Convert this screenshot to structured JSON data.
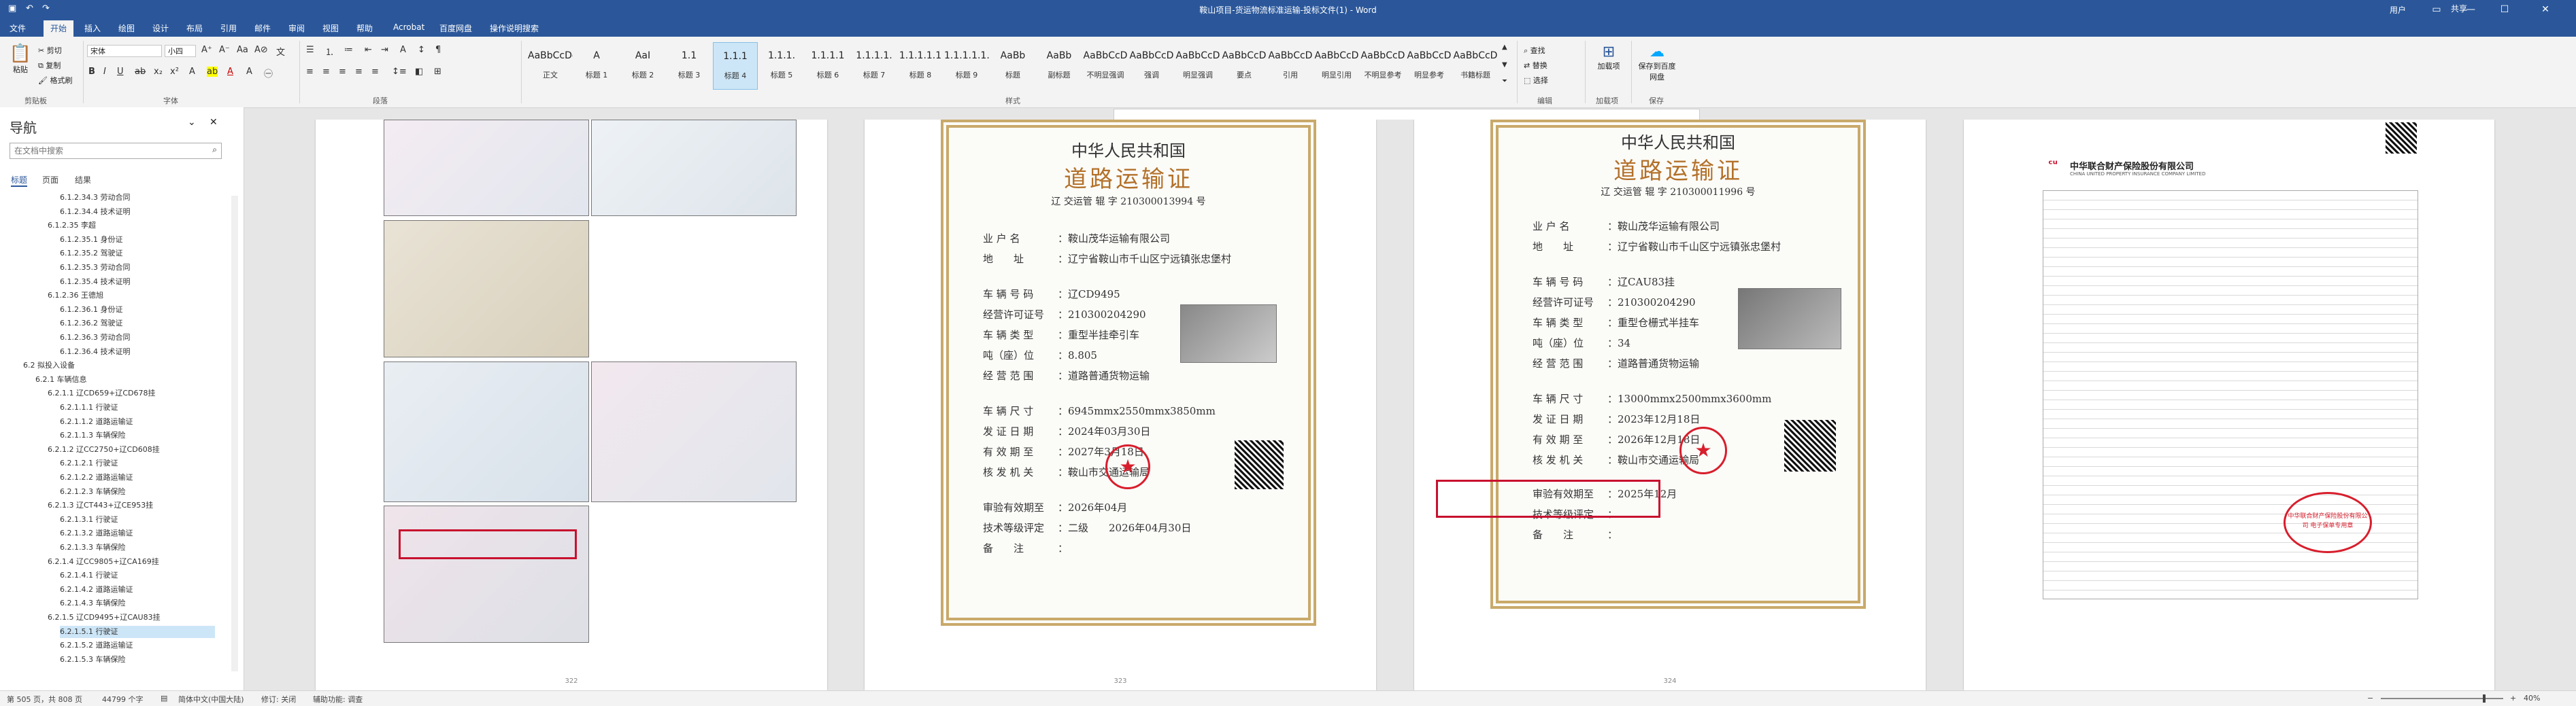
{
  "window": {
    "title": "鞍山项目-货运物流标准运输-投标文件(1) - Word",
    "user": "用户",
    "share": "共享",
    "qa_icons": [
      "save-icon",
      "undo-icon",
      "redo-icon"
    ]
  },
  "tabs": [
    "文件",
    "开始",
    "插入",
    "绘图",
    "设计",
    "布局",
    "引用",
    "邮件",
    "审阅",
    "视图",
    "帮助",
    "Acrobat",
    "百度网盘",
    "操作说明搜索"
  ],
  "active_tab": "开始",
  "ribbon": {
    "clipboard": {
      "paste": "粘贴",
      "cut": "剪切",
      "copy": "复制",
      "format_painter": "格式刷",
      "group": "剪贴板"
    },
    "font": {
      "family": "宋体",
      "size": "小四",
      "group": "字体"
    },
    "paragraph": {
      "group": "段落"
    },
    "styles": {
      "group": "样式",
      "items": [
        {
          "preview": "AaBbCcDd",
          "label": "正文"
        },
        {
          "preview": "A",
          "label": "标题 1"
        },
        {
          "preview": "AaI",
          "label": "标题 2"
        },
        {
          "preview": "1.1",
          "label": "标题 3"
        },
        {
          "preview": "1.1.1",
          "label": "标题 4"
        },
        {
          "preview": "1.1.1.",
          "label": "标题 5"
        },
        {
          "preview": "1.1.1.1",
          "label": "标题 6"
        },
        {
          "preview": "1.1.1.1.",
          "label": "标题 7"
        },
        {
          "preview": "1.1.1.1.1",
          "label": "标题 8"
        },
        {
          "preview": "1.1.1.1.1.",
          "label": "标题 9"
        },
        {
          "preview": "AaBb",
          "label": "标题"
        },
        {
          "preview": "AaBb",
          "label": "副标题"
        },
        {
          "preview": "AaBbCcD",
          "label": "不明显强调"
        },
        {
          "preview": "AaBbCcD",
          "label": "强调"
        },
        {
          "preview": "AaBbCcD",
          "label": "明显强调"
        },
        {
          "preview": "AaBbCcD",
          "label": "要点"
        },
        {
          "preview": "AaBbCcD",
          "label": "引用"
        },
        {
          "preview": "AaBbCcD",
          "label": "明显引用"
        },
        {
          "preview": "AaBbCcD",
          "label": "不明显参考"
        },
        {
          "preview": "AaBbCcD",
          "label": "明显参考"
        },
        {
          "preview": "AaBbCcD",
          "label": "书籍标题"
        }
      ],
      "selected_index": 4
    },
    "editing": {
      "find": "查找",
      "replace": "替换",
      "select": "选择",
      "group": "编辑"
    },
    "addin": {
      "label": "加载项",
      "group": "加载项"
    },
    "save_baidu": {
      "label": "保存到百度网盘",
      "group": "保存"
    }
  },
  "nav": {
    "title": "导航",
    "search_placeholder": "在文档中搜索",
    "tabs": [
      "标题",
      "页面",
      "结果"
    ],
    "items": [
      {
        "text": "6.1.2.34.3 劳动合同",
        "level": 4
      },
      {
        "text": "6.1.2.34.4 技术证明",
        "level": 4
      },
      {
        "text": "6.1.2.35 李超",
        "level": 3
      },
      {
        "text": "6.1.2.35.1 身份证",
        "level": 4
      },
      {
        "text": "6.1.2.35.2 驾驶证",
        "level": 4
      },
      {
        "text": "6.1.2.35.3 劳动合同",
        "level": 4
      },
      {
        "text": "6.1.2.35.4 技术证明",
        "level": 4
      },
      {
        "text": "6.1.2.36 王德旭",
        "level": 3
      },
      {
        "text": "6.1.2.36.1 身份证",
        "level": 4
      },
      {
        "text": "6.1.2.36.2 驾驶证",
        "level": 4
      },
      {
        "text": "6.1.2.36.3 劳动合同",
        "level": 4
      },
      {
        "text": "6.1.2.36.4 技术证明",
        "level": 4
      },
      {
        "text": "6.2 拟投入设备",
        "level": 1
      },
      {
        "text": "6.2.1 车辆信息",
        "level": 2
      },
      {
        "text": "6.2.1.1 辽CD659+辽CD678挂",
        "level": 3
      },
      {
        "text": "6.2.1.1.1 行驶证",
        "level": 4
      },
      {
        "text": "6.2.1.1.2 道路运输证",
        "level": 4
      },
      {
        "text": "6.2.1.1.3 车辆保险",
        "level": 4
      },
      {
        "text": "6.2.1.2 辽CC2750+辽CD608挂",
        "level": 3
      },
      {
        "text": "6.2.1.2.1 行驶证",
        "level": 4
      },
      {
        "text": "6.2.1.2.2 道路运输证",
        "level": 4
      },
      {
        "text": "6.2.1.2.3 车辆保险",
        "level": 4
      },
      {
        "text": "6.2.1.3 辽CT443+辽CE953挂",
        "level": 3
      },
      {
        "text": "6.2.1.3.1 行驶证",
        "level": 4
      },
      {
        "text": "6.2.1.3.2 道路运输证",
        "level": 4
      },
      {
        "text": "6.2.1.3.3 车辆保险",
        "level": 4
      },
      {
        "text": "6.2.1.4 辽CC9805+辽CA169挂",
        "level": 3
      },
      {
        "text": "6.2.1.4.1 行驶证",
        "level": 4
      },
      {
        "text": "6.2.1.4.2 道路运输证",
        "level": 4
      },
      {
        "text": "6.2.1.4.3 车辆保险",
        "level": 4
      },
      {
        "text": "6.2.1.5 辽CD9495+辽CAU83挂",
        "level": 3
      },
      {
        "text": "6.2.1.5.1 行驶证",
        "level": 4
      },
      {
        "text": "6.2.1.5.2 道路运输证",
        "level": 4
      },
      {
        "text": "6.2.1.5.3 车辆保险",
        "level": 4
      }
    ],
    "selected_index": 31
  },
  "doc": {
    "cert1": {
      "heading": "中华人民共和国",
      "subheading": "道路运输证",
      "number": "辽  交运管 辊 字 210300013994  号",
      "rows": [
        {
          "k": "业 户 名",
          "v": "鞍山茂华运输有限公司"
        },
        {
          "k": "地　　址",
          "v": "辽宁省鞍山市千山区宁远镇张忠堡村"
        },
        {
          "k": "车 辆 号 码",
          "v": "辽CD9495"
        },
        {
          "k": "经营许可证号",
          "v": "210300204290"
        },
        {
          "k": "车 辆 类 型",
          "v": "重型半挂牵引车"
        },
        {
          "k": "吨（座）位",
          "v": "8.805"
        },
        {
          "k": "经 营 范 围",
          "v": "道路普通货物运输"
        },
        {
          "k": "车 辆 尺 寸",
          "v": "6945mmx2550mmx3850mm"
        },
        {
          "k": "发 证 日 期",
          "v": "2024年03月30日"
        },
        {
          "k": "有 效 期 至",
          "v": "2027年3月18日"
        },
        {
          "k": "核 发 机 关",
          "v": "鞍山市交通运输局"
        },
        {
          "k": "审验有效期至",
          "v": "2026年04月"
        },
        {
          "k": "技术等级评定",
          "v": "二级　　2026年04月30日"
        },
        {
          "k": "备　　注",
          "v": ""
        }
      ]
    },
    "cert2": {
      "heading": "中华人民共和国",
      "subheading": "道路运输证",
      "number": "辽  交运管 辊 字 210300011996  号",
      "rows": [
        {
          "k": "业 户 名",
          "v": "鞍山茂华运输有限公司"
        },
        {
          "k": "地　　址",
          "v": "辽宁省鞍山市千山区宁远镇张忠堡村"
        },
        {
          "k": "车 辆 号 码",
          "v": "辽CAU83挂"
        },
        {
          "k": "经营许可证号",
          "v": "210300204290"
        },
        {
          "k": "车 辆 类 型",
          "v": "重型仓栅式半挂车"
        },
        {
          "k": "吨（座）位",
          "v": "34"
        },
        {
          "k": "经 营 范 围",
          "v": "道路普通货物运输"
        },
        {
          "k": "车 辆 尺 寸",
          "v": "13000mmx2500mmx3600mm"
        },
        {
          "k": "发 证 日 期",
          "v": "2023年12月18日"
        },
        {
          "k": "有 效 期 至",
          "v": "2026年12月18日"
        },
        {
          "k": "核 发 机 关",
          "v": "鞍山市交通运输局"
        },
        {
          "k": "审验有效期至",
          "v": "2025年12月"
        },
        {
          "k": "技术等级评定",
          "v": ""
        },
        {
          "k": "备　　注",
          "v": ""
        }
      ]
    },
    "policy": {
      "company": "中华联合财产保险股份有限公司",
      "company_en": "CHINA UNITED PROPERTY INSURANCE COMPANY LIMITED",
      "stamp": "中华联合财产保险股份有限公司 电子保单专用章"
    },
    "page_numbers": [
      "322",
      "323",
      "324"
    ]
  },
  "status": {
    "page": "第 505 页，共 808 页",
    "words": "44799 个字",
    "lang": "简体中文(中国大陆)",
    "track": "修订: 关闭",
    "accessibility": "辅助功能: 调查",
    "zoom": "40%"
  },
  "colors": {
    "brand": "#2b579a",
    "highlight": "#c8102e",
    "stamp": "#d81e2c"
  }
}
